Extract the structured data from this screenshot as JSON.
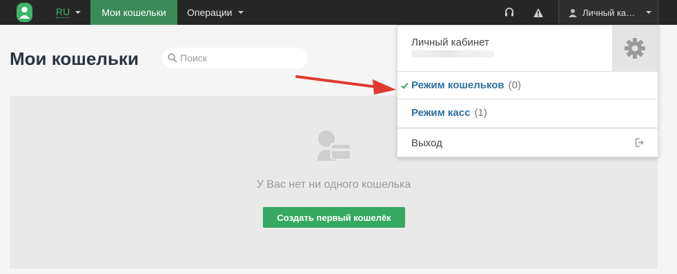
{
  "topbar": {
    "logo_icon": "user-badge-logo-icon",
    "lang": "RU",
    "nav_wallets": "Мои кошельки",
    "nav_operations": "Операции",
    "support_icon": "headset-icon",
    "warning_icon": "warning-icon",
    "account_icon": "user-icon",
    "account_label": "Личный ка…"
  },
  "page": {
    "title": "Мои кошельки",
    "search_placeholder": "Поиск"
  },
  "empty_state": {
    "icon": "wallet-user-icon",
    "message": "У Вас нет ни одного кошелька",
    "create_button": "Создать первый кошелёк"
  },
  "dropdown": {
    "title": "Личный кабинет",
    "gear_icon": "gear-icon",
    "items": [
      {
        "label": "Режим кошельков",
        "count": "(0)",
        "checked": true
      },
      {
        "label": "Режим касс",
        "count": "(1)",
        "checked": false
      }
    ],
    "logout": "Выход",
    "logout_icon": "logout-icon"
  },
  "colors": {
    "topbar": "#262626",
    "active_nav": "#3b8a57",
    "primary_button": "#35a861",
    "mode_link": "#2f6f9f",
    "annotation_arrow": "#e03a2e"
  }
}
